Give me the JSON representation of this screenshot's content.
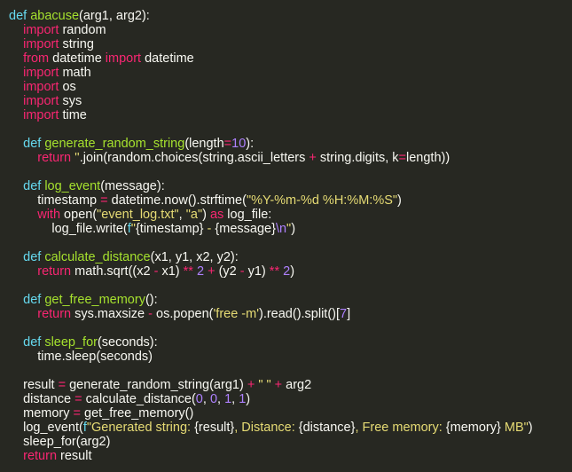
{
  "code": {
    "language": "python",
    "lines": [
      [
        [
          "d",
          "def "
        ],
        [
          "f",
          "abacuse"
        ],
        [
          "t",
          "(arg1, arg2):"
        ]
      ],
      [
        [
          "t",
          "    "
        ],
        [
          "k",
          "import"
        ],
        [
          "t",
          " random"
        ]
      ],
      [
        [
          "t",
          "    "
        ],
        [
          "k",
          "import"
        ],
        [
          "t",
          " string"
        ]
      ],
      [
        [
          "t",
          "    "
        ],
        [
          "k",
          "from"
        ],
        [
          "t",
          " datetime "
        ],
        [
          "k",
          "import"
        ],
        [
          "t",
          " datetime"
        ]
      ],
      [
        [
          "t",
          "    "
        ],
        [
          "k",
          "import"
        ],
        [
          "t",
          " math"
        ]
      ],
      [
        [
          "t",
          "    "
        ],
        [
          "k",
          "import"
        ],
        [
          "t",
          " os"
        ]
      ],
      [
        [
          "t",
          "    "
        ],
        [
          "k",
          "import"
        ],
        [
          "t",
          " sys"
        ]
      ],
      [
        [
          "t",
          "    "
        ],
        [
          "k",
          "import"
        ],
        [
          "t",
          " time"
        ]
      ],
      [],
      [
        [
          "t",
          "    "
        ],
        [
          "d",
          "def "
        ],
        [
          "f",
          "generate_random_string"
        ],
        [
          "t",
          "(length"
        ],
        [
          "o",
          "="
        ],
        [
          "n",
          "10"
        ],
        [
          "t",
          "):"
        ]
      ],
      [
        [
          "t",
          "        "
        ],
        [
          "k",
          "return"
        ],
        [
          "t",
          " "
        ],
        [
          "s",
          "''"
        ],
        [
          "t",
          ".join(random.choices(string.ascii_letters "
        ],
        [
          "o",
          "+"
        ],
        [
          "t",
          " string.digits, k"
        ],
        [
          "o",
          "="
        ],
        [
          "t",
          "length))"
        ]
      ],
      [],
      [
        [
          "t",
          "    "
        ],
        [
          "d",
          "def "
        ],
        [
          "f",
          "log_event"
        ],
        [
          "t",
          "(message):"
        ]
      ],
      [
        [
          "t",
          "        timestamp "
        ],
        [
          "o",
          "="
        ],
        [
          "t",
          " datetime.now().strftime("
        ],
        [
          "s",
          "\"%Y-%m-%d %H:%M:%S\""
        ],
        [
          "t",
          ")"
        ]
      ],
      [
        [
          "t",
          "        "
        ],
        [
          "k",
          "with"
        ],
        [
          "t",
          " open("
        ],
        [
          "s",
          "\"event_log.txt\""
        ],
        [
          "t",
          ", "
        ],
        [
          "s",
          "\"a\""
        ],
        [
          "t",
          ") "
        ],
        [
          "k",
          "as"
        ],
        [
          "t",
          " log_file:"
        ]
      ],
      [
        [
          "t",
          "            log_file.write("
        ],
        [
          "d",
          "f"
        ],
        [
          "s",
          "\""
        ],
        [
          "t",
          "{timestamp}"
        ],
        [
          "s",
          " - "
        ],
        [
          "t",
          "{message}"
        ],
        [
          "n",
          "\\n"
        ],
        [
          "s",
          "\""
        ],
        [
          "t",
          ")"
        ]
      ],
      [],
      [
        [
          "t",
          "    "
        ],
        [
          "d",
          "def "
        ],
        [
          "f",
          "calculate_distance"
        ],
        [
          "t",
          "(x1, y1, x2, y2):"
        ]
      ],
      [
        [
          "t",
          "        "
        ],
        [
          "k",
          "return"
        ],
        [
          "t",
          " math.sqrt((x2 "
        ],
        [
          "o",
          "-"
        ],
        [
          "t",
          " x1) "
        ],
        [
          "o",
          "**"
        ],
        [
          "t",
          " "
        ],
        [
          "n",
          "2"
        ],
        [
          "t",
          " "
        ],
        [
          "o",
          "+"
        ],
        [
          "t",
          " (y2 "
        ],
        [
          "o",
          "-"
        ],
        [
          "t",
          " y1) "
        ],
        [
          "o",
          "**"
        ],
        [
          "t",
          " "
        ],
        [
          "n",
          "2"
        ],
        [
          "t",
          ")"
        ]
      ],
      [],
      [
        [
          "t",
          "    "
        ],
        [
          "d",
          "def "
        ],
        [
          "f",
          "get_free_memory"
        ],
        [
          "t",
          "():"
        ]
      ],
      [
        [
          "t",
          "        "
        ],
        [
          "k",
          "return"
        ],
        [
          "t",
          " sys.maxsize "
        ],
        [
          "o",
          "-"
        ],
        [
          "t",
          " os.popen("
        ],
        [
          "s",
          "'free -m'"
        ],
        [
          "t",
          ").read().split()["
        ],
        [
          "n",
          "7"
        ],
        [
          "t",
          "]"
        ]
      ],
      [],
      [
        [
          "t",
          "    "
        ],
        [
          "d",
          "def "
        ],
        [
          "f",
          "sleep_for"
        ],
        [
          "t",
          "(seconds):"
        ]
      ],
      [
        [
          "t",
          "        time.sleep(seconds)"
        ]
      ],
      [],
      [
        [
          "t",
          "    result "
        ],
        [
          "o",
          "="
        ],
        [
          "t",
          " generate_random_string(arg1) "
        ],
        [
          "o",
          "+"
        ],
        [
          "t",
          " "
        ],
        [
          "s",
          "\" \""
        ],
        [
          "t",
          " "
        ],
        [
          "o",
          "+"
        ],
        [
          "t",
          " arg2"
        ]
      ],
      [
        [
          "t",
          "    distance "
        ],
        [
          "o",
          "="
        ],
        [
          "t",
          " calculate_distance("
        ],
        [
          "n",
          "0"
        ],
        [
          "t",
          ", "
        ],
        [
          "n",
          "0"
        ],
        [
          "t",
          ", "
        ],
        [
          "n",
          "1"
        ],
        [
          "t",
          ", "
        ],
        [
          "n",
          "1"
        ],
        [
          "t",
          ")"
        ]
      ],
      [
        [
          "t",
          "    memory "
        ],
        [
          "o",
          "="
        ],
        [
          "t",
          " get_free_memory()"
        ]
      ],
      [
        [
          "t",
          "    log_event("
        ],
        [
          "d",
          "f"
        ],
        [
          "s",
          "\"Generated string: "
        ],
        [
          "t",
          "{result}"
        ],
        [
          "s",
          ", Distance: "
        ],
        [
          "t",
          "{distance}"
        ],
        [
          "s",
          ", Free memory: "
        ],
        [
          "t",
          "{memory}"
        ],
        [
          "s",
          " MB\""
        ],
        [
          "t",
          ")"
        ]
      ],
      [
        [
          "t",
          "    sleep_for(arg2)"
        ]
      ],
      [
        [
          "t",
          "    "
        ],
        [
          "k",
          "return"
        ],
        [
          "t",
          " result"
        ]
      ]
    ]
  },
  "colors": {
    "background": "#272822",
    "keyword": "#f92672",
    "def": "#66d9ef",
    "function": "#a6e22e",
    "string": "#e6db74",
    "number": "#ae81ff",
    "text": "#f8f8f2"
  }
}
